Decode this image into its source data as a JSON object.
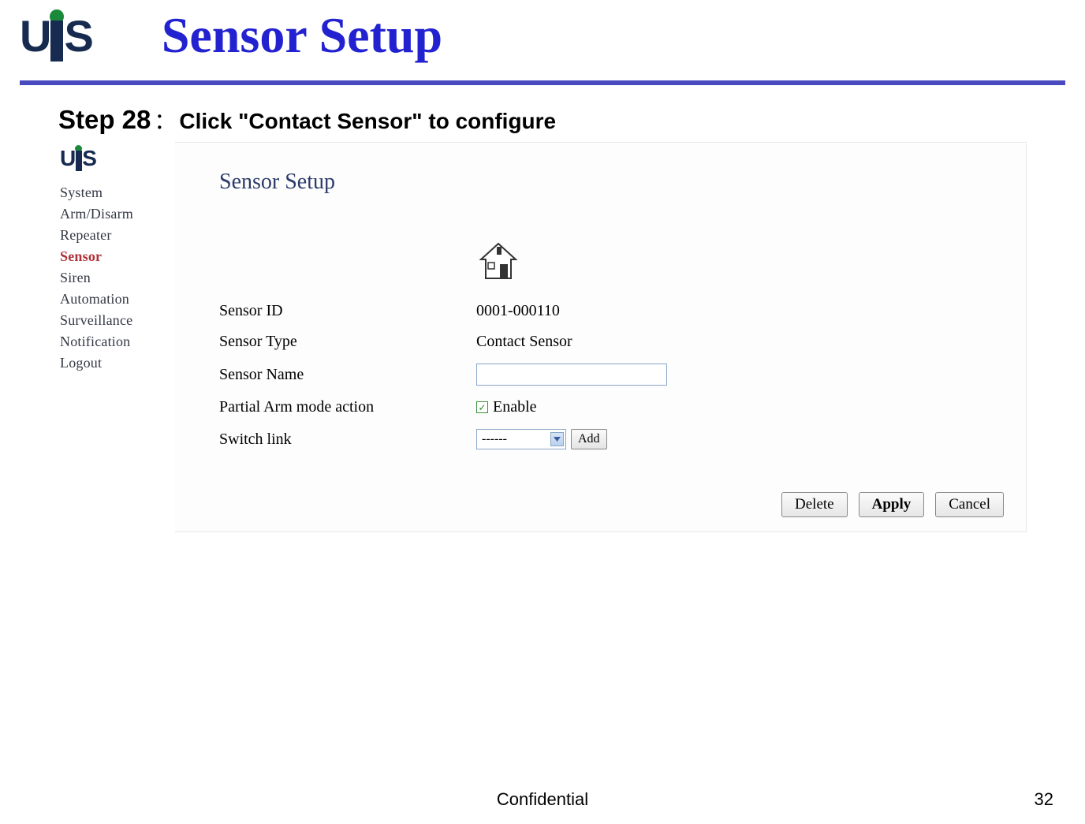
{
  "slide": {
    "title": "Sensor Setup",
    "step_number": "Step 28",
    "colon": "：",
    "step_desc": "Click \"Contact Sensor\" to configure"
  },
  "nav": {
    "items": [
      {
        "label": "System",
        "active": false
      },
      {
        "label": "Arm/Disarm",
        "active": false
      },
      {
        "label": "Repeater",
        "active": false
      },
      {
        "label": "Sensor",
        "active": true
      },
      {
        "label": "Siren",
        "active": false
      },
      {
        "label": "Automation",
        "active": false
      },
      {
        "label": "Surveillance",
        "active": false
      },
      {
        "label": "Notification",
        "active": false
      },
      {
        "label": "Logout",
        "active": false
      }
    ]
  },
  "panel": {
    "title": "Sensor Setup",
    "rows": {
      "sensor_id": {
        "label": "Sensor ID",
        "value": "0001-000110"
      },
      "sensor_type": {
        "label": "Sensor Type",
        "value": "Contact Sensor"
      },
      "sensor_name": {
        "label": "Sensor Name",
        "value": ""
      },
      "partial_arm": {
        "label": "Partial Arm mode action",
        "value": "Enable",
        "checked": true
      },
      "switch_link": {
        "label": "Switch link",
        "selected": "------",
        "add": "Add"
      }
    },
    "buttons": {
      "delete": "Delete",
      "apply": "Apply",
      "cancel": "Cancel"
    }
  },
  "footer": {
    "confidential": "Confidential",
    "page": "32"
  }
}
